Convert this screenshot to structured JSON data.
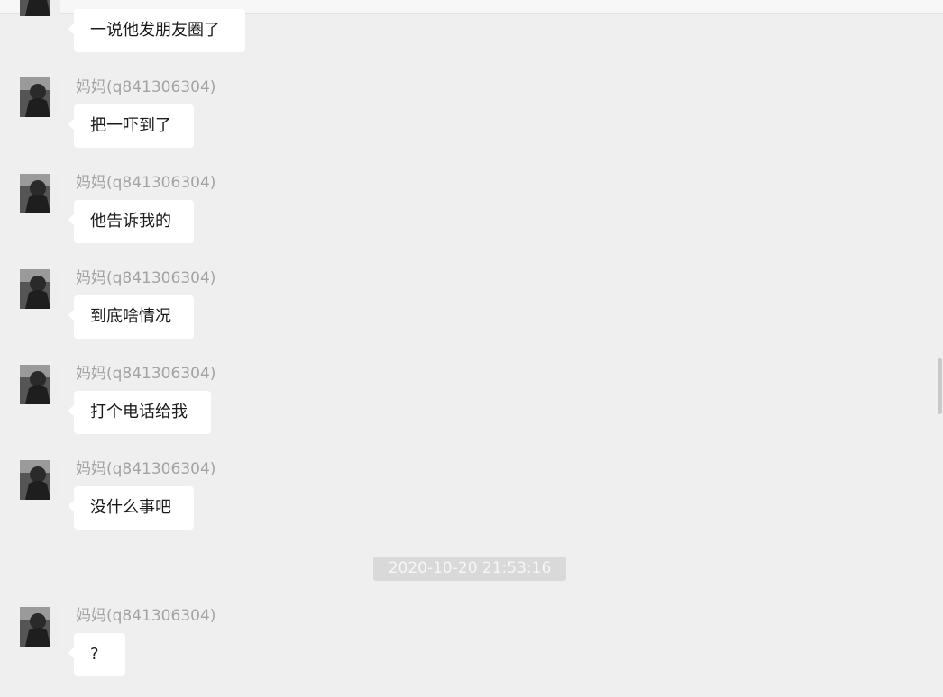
{
  "sender_name": "妈妈(q841306304)",
  "messages": [
    {
      "text": "一说他发朋友圈了"
    },
    {
      "text": "把一吓到了"
    },
    {
      "text": "他告诉我的"
    },
    {
      "text": "到底啥情况"
    },
    {
      "text": "打个电话给我"
    },
    {
      "text": "没什么事吧"
    },
    {
      "text": "?"
    }
  ],
  "timestamp": "2020-10-20 21:53:16"
}
